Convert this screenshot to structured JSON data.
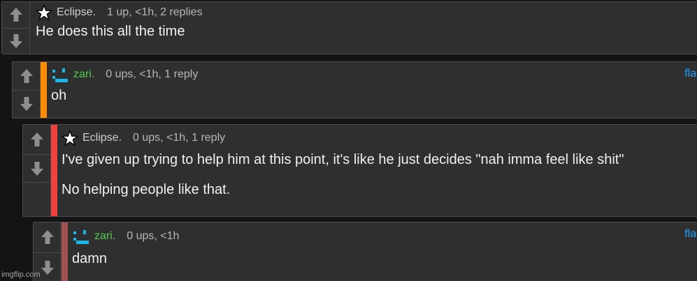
{
  "comments": [
    {
      "user": "Eclipse.",
      "meta": "1 up, <1h, 2 replies",
      "lines": [
        "He does this all the time"
      ],
      "avatar": "star-icon",
      "stripe_color": "",
      "flag": ""
    },
    {
      "user": "zari.",
      "meta": "0 ups, <1h, 1 reply",
      "lines": [
        "oh"
      ],
      "avatar": "pixel-face-avatar",
      "stripe_color": "#ff8c00",
      "flag": "flag"
    },
    {
      "user": "Eclipse.",
      "meta": "0 ups, <1h, 1 reply",
      "lines": [
        "I've given up trying to help him at this point, it's like he just decides \"nah imma feel like shit\"",
        "No helping people like that."
      ],
      "avatar": "star-icon",
      "stripe_color": "#f04040",
      "flag": ""
    },
    {
      "user": "zari.",
      "meta": "0 ups, <1h",
      "lines": [
        "damn"
      ],
      "avatar": "pixel-face-avatar",
      "stripe_color": "#a35050",
      "flag": "flag"
    }
  ],
  "vote_icons": {
    "up": "arrow-up-icon",
    "down": "arrow-down-icon"
  },
  "colors": {
    "background": "#141414",
    "panel": "#2f2f2f",
    "username_green": "#4fcc4f",
    "flag_link": "#1ea0ff",
    "avatar_cyan": "#1ab8ea"
  },
  "watermark": "imgflip.com"
}
